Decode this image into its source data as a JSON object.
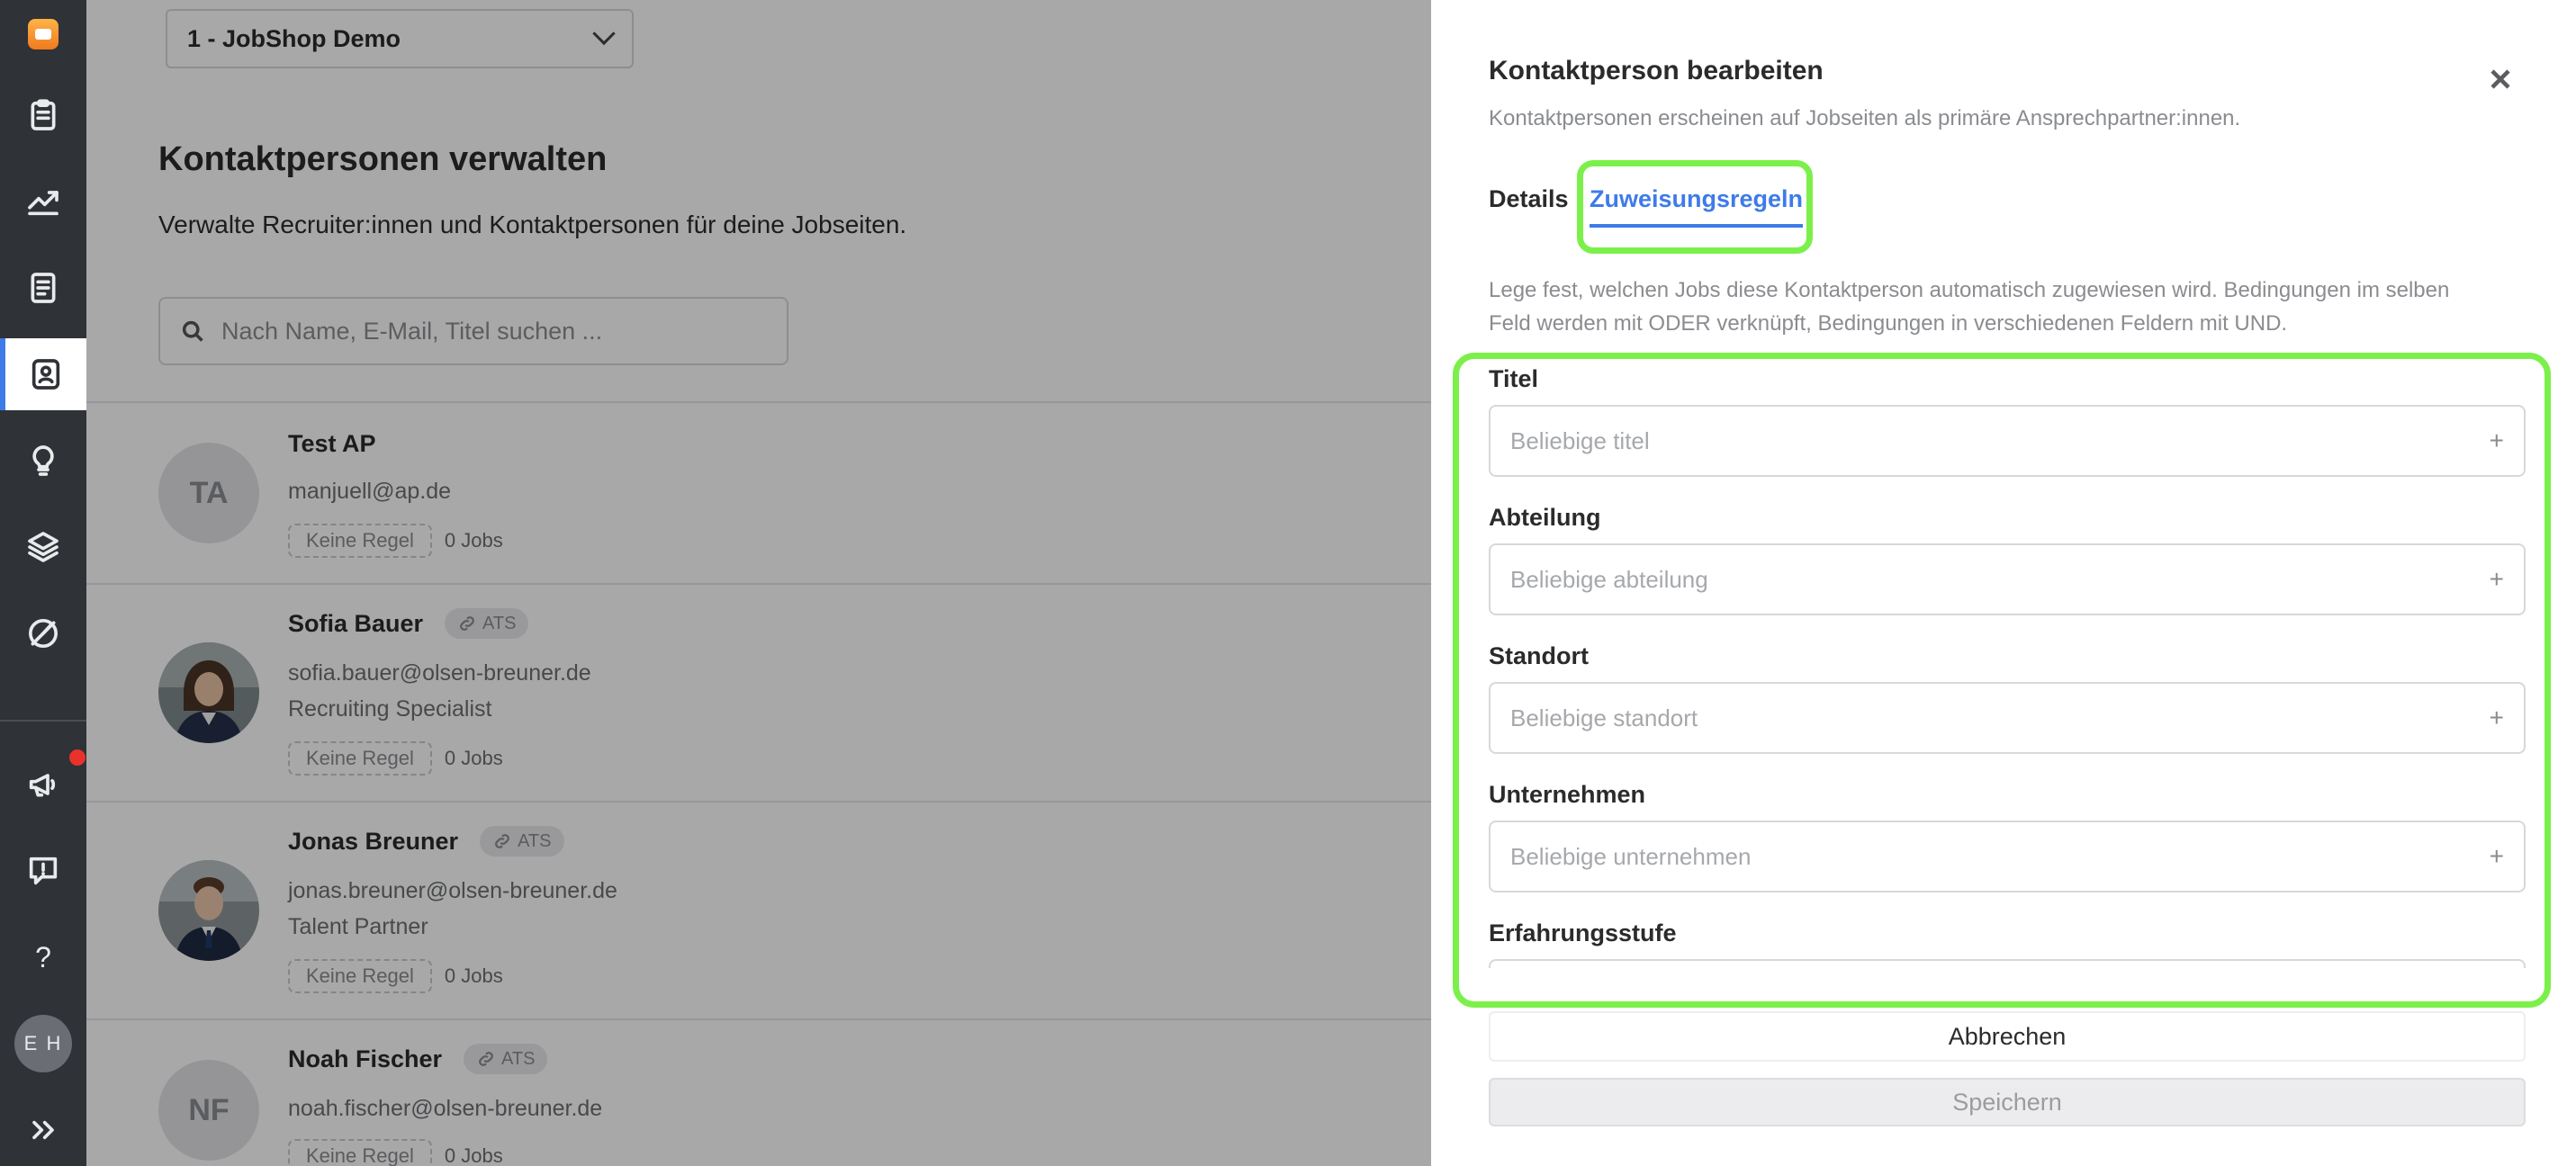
{
  "workspace_select": {
    "value": "1 - JobShop Demo"
  },
  "page": {
    "title": "Kontaktpersonen verwalten",
    "subtitle": "Verwalte Recruiter:innen und Kontaktpersonen für deine Jobseiten.",
    "search_placeholder": "Nach Name, E-Mail, Titel suchen ..."
  },
  "contacts": [
    {
      "initials": "TA",
      "name": "Test AP",
      "ats": "",
      "email": "manjuell@ap.de",
      "role": "",
      "rule": "Keine Regel",
      "jobs": "0 Jobs"
    },
    {
      "initials": "",
      "name": "Sofia Bauer",
      "ats": "ATS",
      "email": "sofia.bauer@olsen-breuner.de",
      "role": "Recruiting Specialist",
      "rule": "Keine Regel",
      "jobs": "0 Jobs"
    },
    {
      "initials": "",
      "name": "Jonas Breuner",
      "ats": "ATS",
      "email": "jonas.breuner@olsen-breuner.de",
      "role": "Talent Partner",
      "rule": "Keine Regel",
      "jobs": "0 Jobs"
    },
    {
      "initials": "NF",
      "name": "Noah Fischer",
      "ats": "ATS",
      "email": "noah.fischer@olsen-breuner.de",
      "role": "",
      "rule": "Keine Regel",
      "jobs": "0 Jobs"
    }
  ],
  "sidebar": {
    "icons": [
      "app-logo-icon",
      "clipboard-icon",
      "chart-trend-icon",
      "document-icon",
      "contact-book-icon",
      "lightbulb-icon",
      "layers-icon",
      "gauge-icon",
      "megaphone-icon",
      "feedback-icon",
      "help-icon",
      "expand-icon"
    ],
    "help_label": "?",
    "user_initials": "E H",
    "accent_color": "#3f7be8"
  },
  "drawer": {
    "title": "Kontaktperson bearbeiten",
    "subtitle": "Kontaktpersonen erscheinen auf Jobseiten als primäre Ansprechpartner:innen.",
    "tabs": [
      "Details",
      "Zuweisungsregeln"
    ],
    "active_tab": "Zuweisungsregeln",
    "description": "Lege fest, welchen Jobs diese Kontaktperson automatisch zugewiesen wird. Bedingungen im selben Feld werden mit ODER verknüpft, Bedingungen in verschiedenen Feldern mit UND.",
    "fields": [
      {
        "label": "Titel",
        "placeholder": "Beliebige titel"
      },
      {
        "label": "Abteilung",
        "placeholder": "Beliebige abteilung"
      },
      {
        "label": "Standort",
        "placeholder": "Beliebige standort"
      },
      {
        "label": "Unternehmen",
        "placeholder": "Beliebige unternehmen"
      },
      {
        "label": "Erfahrungsstufe",
        "placeholder": ""
      }
    ],
    "add_symbol": "+",
    "cancel_label": "Abbrechen",
    "save_label": "Speichern",
    "highlight_color": "#7cf04a"
  }
}
